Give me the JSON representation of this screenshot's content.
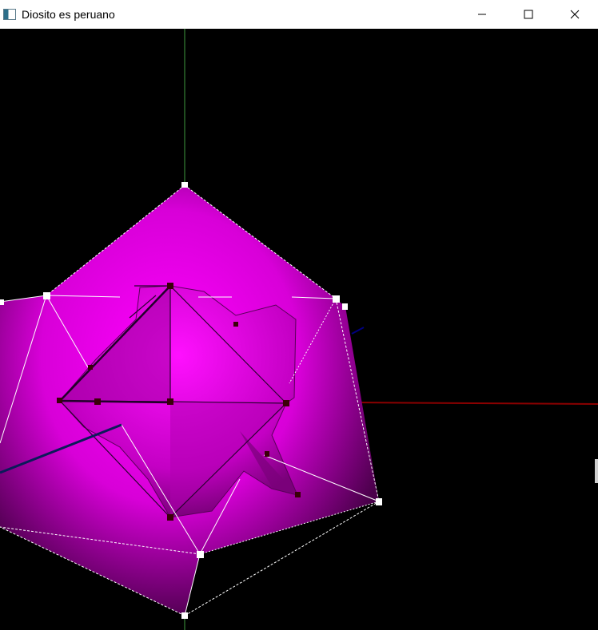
{
  "window": {
    "title": "Diosito es peruano",
    "icon": "app-window-icon",
    "controls": [
      "minimize-icon",
      "maximize-icon",
      "close-icon"
    ]
  },
  "scene": {
    "shape_color": "#ff00ff",
    "axis_colors": {
      "x": "#8b0000",
      "y": "#1f4d1f",
      "z": "#000080"
    }
  }
}
